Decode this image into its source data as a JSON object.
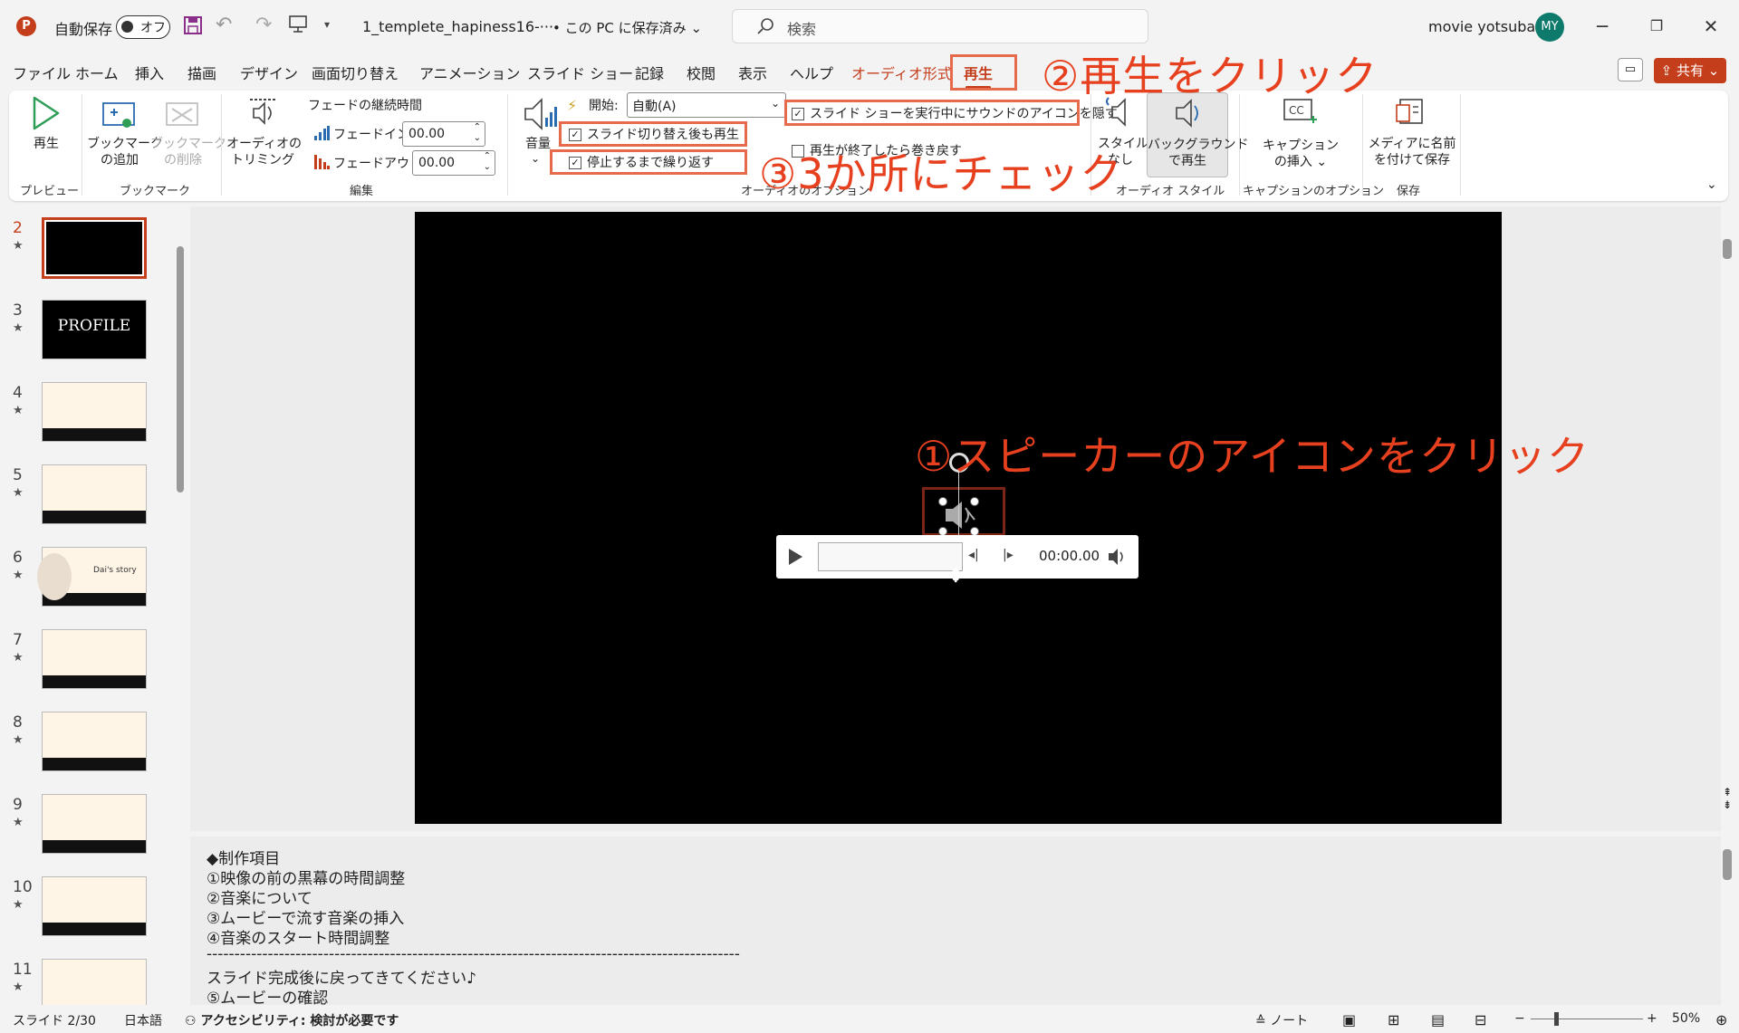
{
  "titlebar": {
    "autosave_label": "自動保存",
    "autosave_state": "オフ",
    "filename": "1_templete_hapiness16-···",
    "save_location": "• この PC に保存済み",
    "search_placeholder": "検索",
    "user_name": "movie yotsuba",
    "user_initials": "MY"
  },
  "tabs": [
    "ファイル",
    "ホーム",
    "挿入",
    "描画",
    "デザイン",
    "画面切り替え",
    "アニメーション",
    "スライド ショー",
    "記録",
    "校閲",
    "表示",
    "ヘルプ",
    "オーディオ形式",
    "再生"
  ],
  "share_label": "共有",
  "ribbon": {
    "play": "再生",
    "add_bookmark": [
      "ブックマーク",
      "の追加"
    ],
    "remove_bookmark": [
      "ブックマーク",
      "の削除"
    ],
    "trim_audio": [
      "オーディオの",
      "トリミング"
    ],
    "fade_duration": "フェードの継続時間",
    "fade_in_label": "フェードイン:",
    "fade_in_value": "00.00",
    "fade_out_label": "フェードアウト:",
    "fade_out_value": "00.00",
    "volume": "音量",
    "start_label": "開始:",
    "start_value": "自動(A)",
    "play_across_slides": "スライド切り替え後も再生",
    "loop_until_stopped": "停止するまで繰り返す",
    "hide_during_show": "スライド ショーを実行中にサウンドのアイコンを隠す",
    "rewind_after_playing": "再生が終了したら巻き戻す",
    "no_style": [
      "スタイル",
      "なし"
    ],
    "play_in_background": [
      "バックグラウンド",
      "で再生"
    ],
    "insert_caption": [
      "キャプション",
      "の挿入 ⌄"
    ],
    "save_media_as": [
      "メディアに名前",
      "を付けて保存"
    ],
    "groups": [
      "プレビュー",
      "ブックマーク",
      "編集",
      "オーディオのオプション",
      "オーディオ スタイル",
      "キャプションのオプション",
      "保存"
    ]
  },
  "annotations": {
    "step1": "①スピーカーのアイコンをクリック",
    "step2": "②再生をクリック",
    "step3": "③3か所にチェック"
  },
  "thumbnails": [
    {
      "num": "2",
      "selected": true
    },
    {
      "num": "3",
      "text": "PROFILE"
    },
    {
      "num": "4"
    },
    {
      "num": "5"
    },
    {
      "num": "6",
      "text": "Dai's story"
    },
    {
      "num": "7"
    },
    {
      "num": "8"
    },
    {
      "num": "9"
    },
    {
      "num": "10"
    },
    {
      "num": "11"
    }
  ],
  "player_time": "00:00.00",
  "notes": [
    "◆制作項目",
    "①映像の前の黒幕の時間調整",
    "②音楽について",
    "③ムービーで流す音楽の挿入",
    "④音楽のスタート時間調整",
    "------------------------------------------------------------------------------------------------",
    "スライド完成後に戻ってきてください♪",
    "⑤ムービーの確認"
  ],
  "status": {
    "slide": "スライド 2/30",
    "language": "日本語",
    "accessibility": "アクセシビリティ: 検討が必要です",
    "notes_button": "ノート",
    "zoom": "50%"
  },
  "colors": {
    "accent": "#c43e1c",
    "annotation": "#e6401f",
    "annotation_box": "#e86a4d"
  }
}
